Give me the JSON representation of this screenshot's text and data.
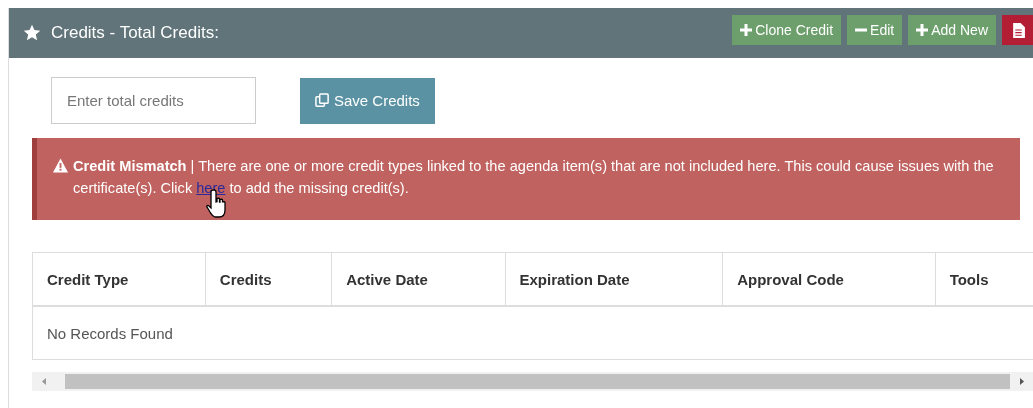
{
  "panel": {
    "title": "Credits - Total Credits:",
    "buttons": [
      {
        "kind": "plus",
        "label": "Clone Credit"
      },
      {
        "kind": "minus",
        "label": "Edit"
      },
      {
        "kind": "plus",
        "label": "Add New"
      },
      {
        "kind": "pdf"
      }
    ]
  },
  "total_credits": {
    "placeholder": "Enter total credits"
  },
  "save_button": {
    "label": "Save Credits"
  },
  "alert": {
    "text": "**Credit Mismatch** | There are one or more credit types linked to the agenda item(s) that are not included here. This could cause issues with the certificate(s). Click",
    "link": "here",
    "text_after": "to add the missing credit(s)."
  },
  "table": {
    "columns": [
      "Credit Type",
      "Credits",
      "Active Date",
      "Expiration Date",
      "Approval Code",
      "Tools"
    ],
    "empty_message": "No Records Found"
  }
}
